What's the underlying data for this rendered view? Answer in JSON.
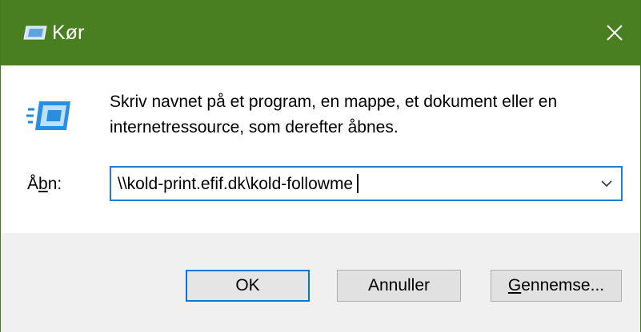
{
  "window": {
    "title": "Kør",
    "accent_color": "#4a7f21",
    "icons": {
      "title": "run-icon",
      "close": "close-icon",
      "main": "run-icon"
    }
  },
  "content": {
    "description": "Skriv navnet på et program, en mappe, et dokument eller en internetressource, som derefter åbnes.",
    "open_label": {
      "prefix": "Å",
      "accel": "b",
      "suffix": "n:"
    },
    "combo": {
      "value": "\\\\kold-print.efif.dk\\kold-followme"
    }
  },
  "buttons": {
    "ok": "OK",
    "cancel": "Annuller",
    "browse": {
      "accel": "G",
      "rest": "ennemse..."
    }
  }
}
